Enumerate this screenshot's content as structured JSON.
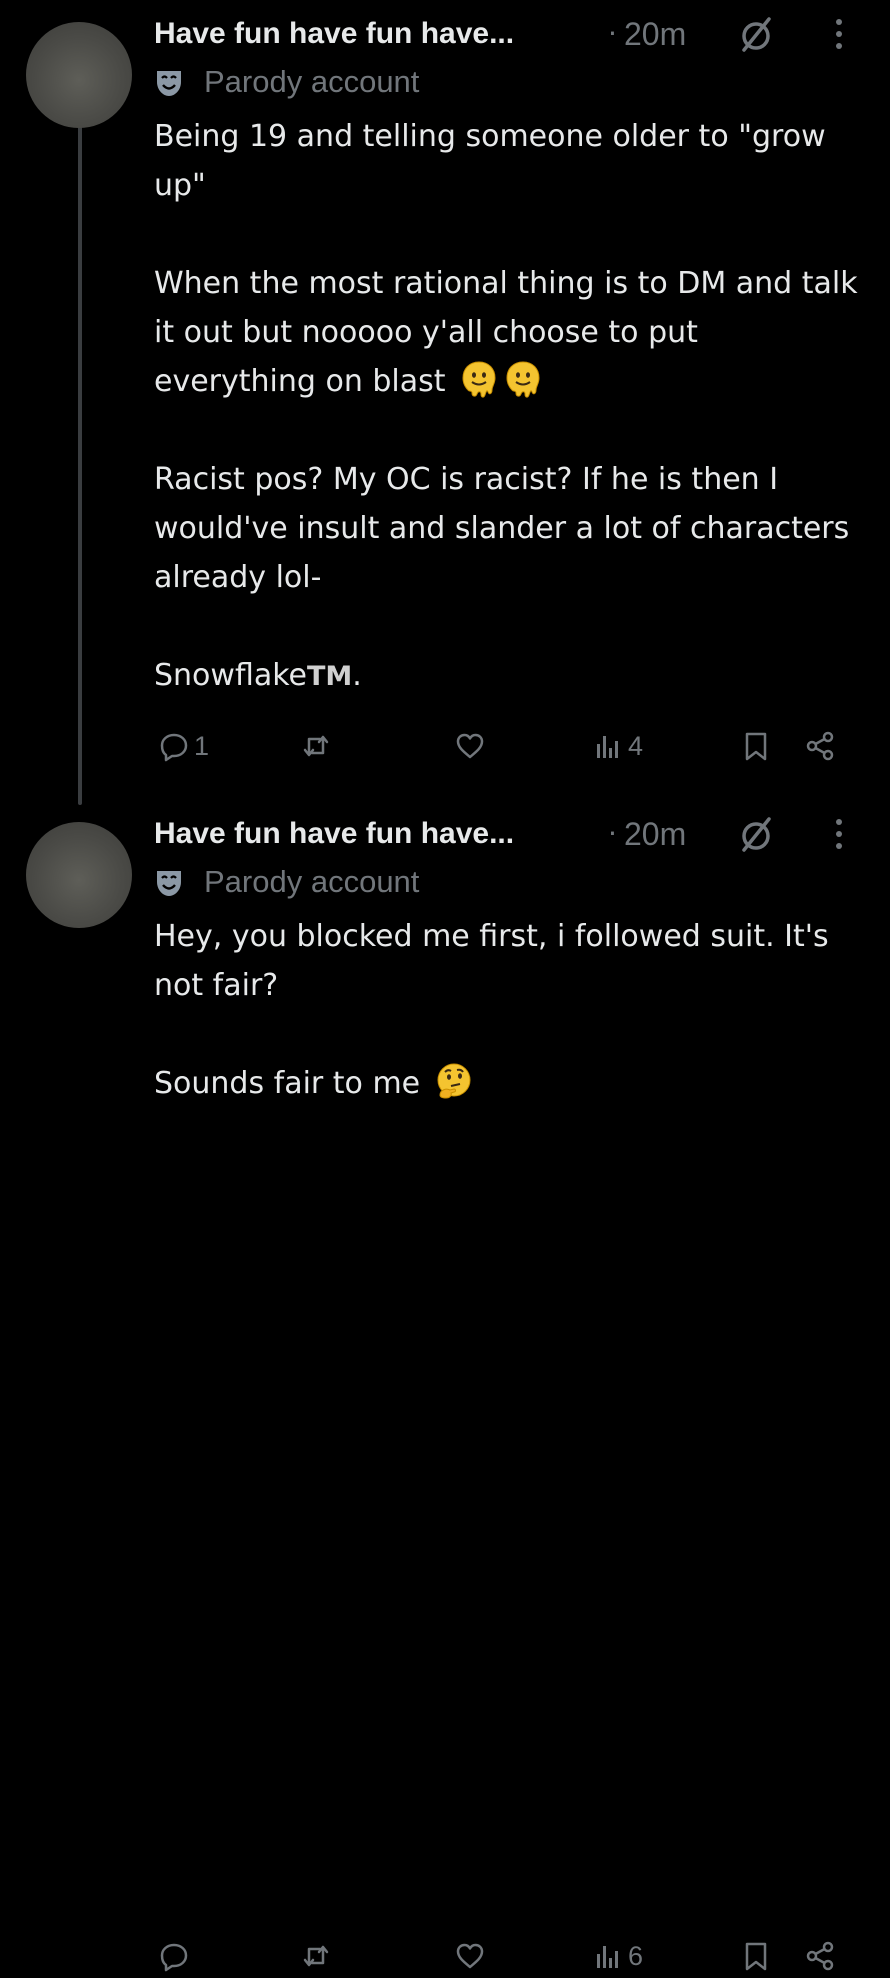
{
  "posts": [
    {
      "author": "Have fun have fun have...",
      "separator": "·",
      "time": "20m",
      "badge": "Parody account",
      "paragraphs": [
        "Being 19 and telling someone older to \"grow up\"",
        "When the most rational thing is to DM and talk it out but nooooo y'all choose to put everything on blast",
        "Racist pos? My OC is racist? If he is then I would've insult and slander a lot of characters already lol-",
        "Snowflake"
      ],
      "tm": "TM",
      "period": ".",
      "emoji": [
        "melting-face-emoji",
        "melting-face-emoji"
      ],
      "stats": {
        "replies": "1",
        "reposts": "",
        "likes": "",
        "views": "4"
      }
    },
    {
      "author": "Have fun have fun have...",
      "separator": "·",
      "time": "20m",
      "badge": "Parody account",
      "paragraphs": [
        "Hey, you blocked me first, i followed suit. It's not fair?",
        "Sounds fair to me"
      ],
      "emoji": [
        "thinking-face-emoji"
      ],
      "stats": {
        "replies": "",
        "reposts": "",
        "likes": "",
        "views": "6"
      }
    }
  ],
  "colors": {
    "background": "#000000",
    "text": "#e7e9ea",
    "muted": "#71767b",
    "thread_line": "#3a3d40"
  }
}
